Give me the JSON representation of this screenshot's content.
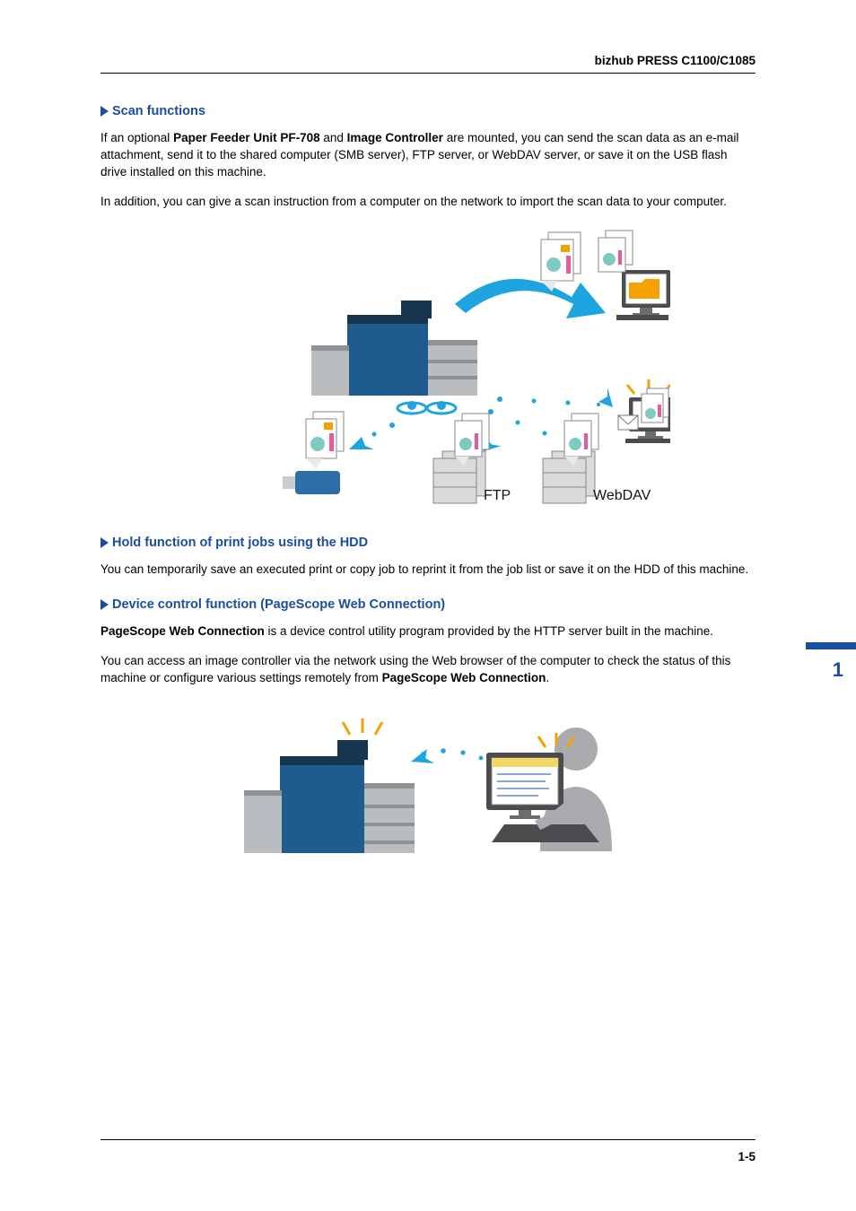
{
  "header": {
    "product": "bizhub PRESS C1100/C1085"
  },
  "sections": {
    "scan": {
      "title": "Scan functions",
      "p1_a": "If an optional ",
      "p1_b1": "Paper Feeder Unit PF-708",
      "p1_c": " and ",
      "p1_b2": "Image Controller",
      "p1_d": " are mounted, you can send the scan data as an e-mail attachment, send it to the shared computer (SMB server), FTP server, or WebDAV server, or save it on the USB flash drive installed on this machine.",
      "p2": "In addition, you can give a scan instruction from a computer on the network to import the scan data to your computer."
    },
    "hold": {
      "title": "Hold function of print jobs using the HDD",
      "p1": "You can temporarily save an executed print or copy job to reprint it from the job list or save it on the HDD of this machine."
    },
    "device": {
      "title": "Device control function (PageScope Web Connection)",
      "p1_b": "PageScope Web Connection",
      "p1_a": " is a device control utility program provided by the HTTP server built in the machine.",
      "p2_a": "You can access an image controller via the network using the Web browser of the computer to check the status of this machine or configure various settings remotely from ",
      "p2_b": "PageScope Web Connection",
      "p2_c": "."
    }
  },
  "figure1": {
    "label_ftp": "FTP",
    "label_webdav": "WebDAV"
  },
  "sidetab": {
    "chapter": "1"
  },
  "footer": {
    "page": "1-5"
  }
}
